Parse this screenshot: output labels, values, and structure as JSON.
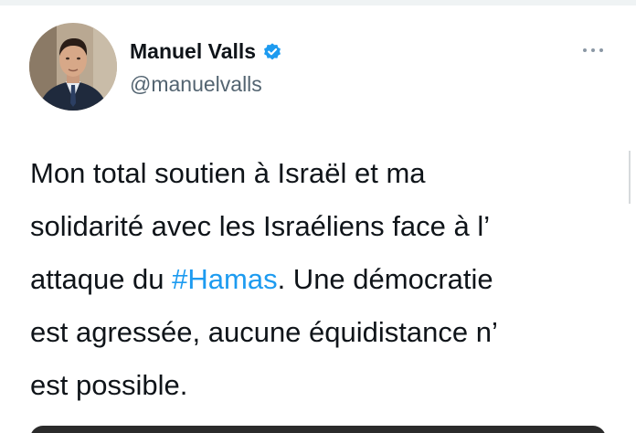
{
  "user": {
    "display_name": "Manuel Valls",
    "handle": "@manuelvalls",
    "verified": true
  },
  "tweet": {
    "line1": "Mon total soutien à Israël et ma",
    "line2": "solidarité avec les Israéliens face à l’",
    "line3_before": "attaque du ",
    "hashtag": "#Hamas",
    "line3_after": ". Une démocratie",
    "line4": "est agressée, aucune équidistance n’",
    "line5": "est possible."
  },
  "icons": {
    "verified": "verified-badge-icon",
    "more": "more-options-icon"
  },
  "colors": {
    "text": "#0f1419",
    "secondary": "#536471",
    "accent": "#1d9bf0"
  }
}
